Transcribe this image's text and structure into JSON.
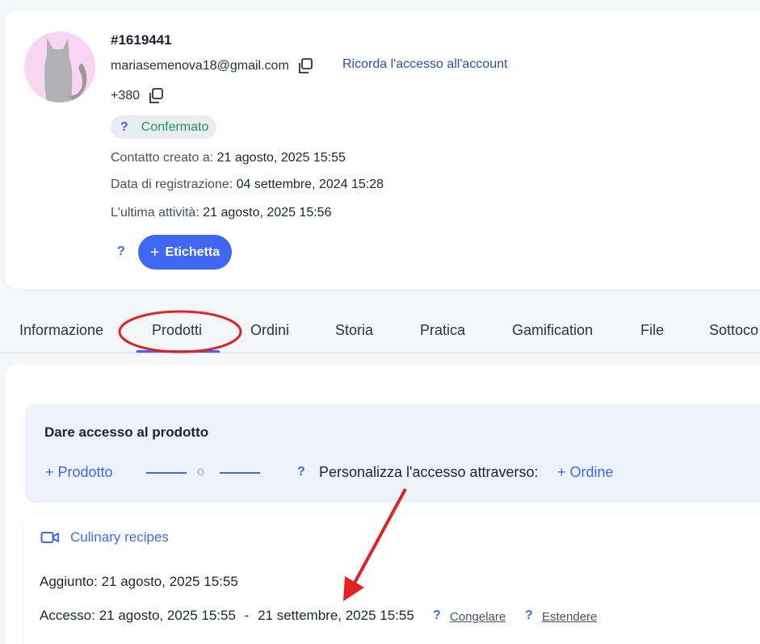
{
  "profile": {
    "id": "#1619441",
    "email": "mariasemenova18@gmail.com",
    "remember_access_link": "Ricorda l'accesso all'account",
    "phone": "+380",
    "status_help": "?",
    "status": "Confermato",
    "created_label": "Contatto creato a:",
    "created_value": "21 agosto, 2025 15:55",
    "registration_label": "Data di registrazione:",
    "registration_value": "04 settembre, 2024 15:28",
    "last_activity_label": "L'ultima attività:",
    "last_activity_value": "21 agosto, 2025 15:56",
    "tag_help": "?",
    "tag_button_plus": "+",
    "tag_button_label": "Etichetta"
  },
  "tabs": [
    {
      "label": "Informazione"
    },
    {
      "label": "Prodotti",
      "active": true
    },
    {
      "label": "Ordini"
    },
    {
      "label": "Storia"
    },
    {
      "label": "Pratica"
    },
    {
      "label": "Gamification"
    },
    {
      "label": "File"
    },
    {
      "label": "Sottoco"
    }
  ],
  "access": {
    "title": "Dare accesso al prodotto",
    "add_product": "+ Prodotto",
    "or_text": "o",
    "help": "?",
    "personalize_label": "Personalizza l'accesso attraverso:",
    "add_order": "+ Ordine"
  },
  "product": {
    "name": "Culinary recipes",
    "added_label": "Aggiunto:",
    "added_value": "21 agosto, 2025 15:55",
    "access_label": "Accesso:",
    "access_from": "21 agosto, 2025 15:55",
    "access_sep": "-",
    "access_to": "21 settembre, 2025 15:55",
    "freeze_help": "?",
    "freeze_label": "Congelare",
    "extend_help": "?",
    "extend_label": "Estendere"
  },
  "colors": {
    "accent": "#3f67f4",
    "status_green": "#1f9a5e",
    "annotation_red": "#e02424",
    "avatar_bg": "#f8d5f1"
  },
  "icons": {
    "avatar": "cat-silhouette-icon",
    "copy": "copy-icon",
    "product_type": "video-camera-icon"
  }
}
